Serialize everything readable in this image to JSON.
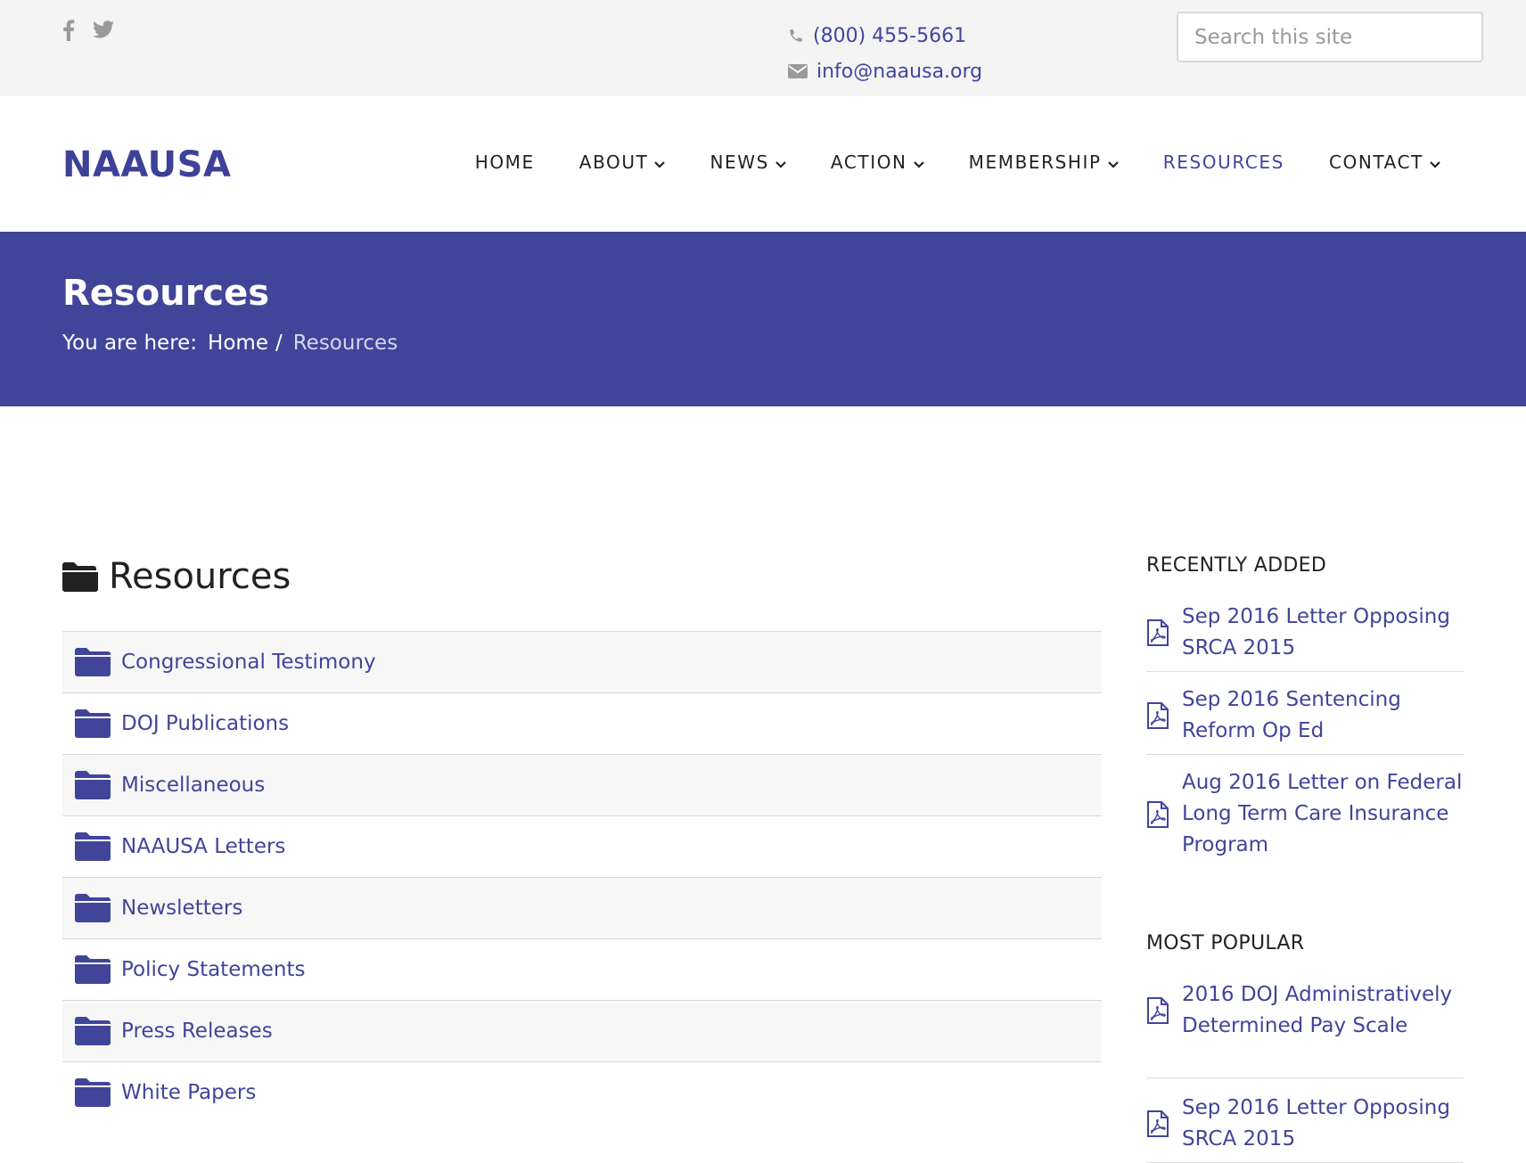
{
  "topbar": {
    "social_icons": [
      "facebook-icon",
      "twitter-icon"
    ],
    "phone": "(800) 455-5661",
    "email": "info@naausa.org",
    "search_placeholder": "Search this site"
  },
  "header": {
    "logo": "NAAUSA",
    "nav": [
      {
        "label": "HOME",
        "dropdown": false,
        "active": false
      },
      {
        "label": "ABOUT",
        "dropdown": true,
        "active": false
      },
      {
        "label": "NEWS",
        "dropdown": true,
        "active": false
      },
      {
        "label": "ACTION",
        "dropdown": true,
        "active": false
      },
      {
        "label": "MEMBERSHIP",
        "dropdown": true,
        "active": false
      },
      {
        "label": "RESOURCES",
        "dropdown": false,
        "active": true
      },
      {
        "label": "CONTACT",
        "dropdown": true,
        "active": false
      }
    ]
  },
  "banner": {
    "title": "Resources",
    "breadcrumb_prefix": "You are here:",
    "breadcrumb_home": "Home",
    "breadcrumb_separator": "/",
    "breadcrumb_current": "Resources"
  },
  "main": {
    "title": "Resources",
    "categories": [
      "Congressional Testimony",
      "DOJ Publications",
      "Miscellaneous",
      "NAAUSA Letters",
      "Newsletters",
      "Policy Statements",
      "Press Releases",
      "White Papers"
    ]
  },
  "sidebar": {
    "recently_added": {
      "heading": "RECENTLY ADDED",
      "items": [
        "Sep 2016 Letter Opposing SRCA 2015",
        "Sep 2016 Sentencing Reform Op Ed",
        "Aug 2016 Letter on Federal Long Term Care Insurance Program"
      ]
    },
    "most_popular": {
      "heading": "MOST POPULAR",
      "items": [
        "2016 DOJ Administratively Determined Pay Scale",
        "Sep 2016 Letter Opposing SRCA 2015"
      ]
    }
  },
  "colors": {
    "brand": "#40459a",
    "topbar_bg": "#f4f4f4",
    "row_shade": "#f7f7f7"
  }
}
